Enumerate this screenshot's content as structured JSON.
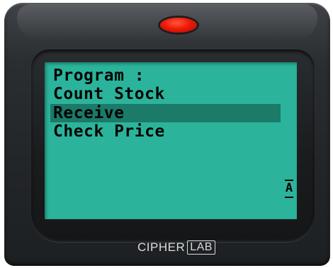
{
  "device": {
    "brand_prefix": "CIPHER",
    "brand_suffix": "LAB",
    "led_color": "#f01a08"
  },
  "screen": {
    "background_color": "#2bb49b",
    "highlight_color": "#1b7a68",
    "title": "Program :",
    "menu_items": [
      {
        "label": "Count Stock",
        "selected": false
      },
      {
        "label": "Receive",
        "selected": true
      },
      {
        "label": "Check Price",
        "selected": false
      }
    ],
    "input_mode_indicator": "A"
  }
}
